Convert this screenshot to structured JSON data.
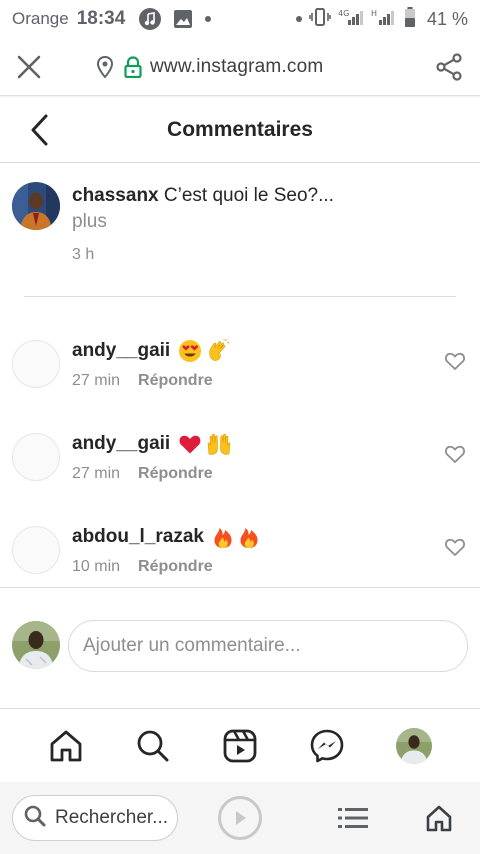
{
  "status_bar": {
    "carrier": "Orange",
    "time": "18:34",
    "battery": "41 %"
  },
  "browser": {
    "url": "www.instagram.com",
    "search_placeholder": "Rechercher..."
  },
  "header": {
    "title": "Commentaires"
  },
  "post": {
    "username": "chassanx",
    "caption": "C’est quoi le Seo?...",
    "more": "plus",
    "time": "3 h"
  },
  "comments": [
    {
      "username": "andy__gaii",
      "emojis": [
        "heart-eyes-emoji",
        "clap-emoji"
      ],
      "time": "27 min",
      "reply": "Répondre"
    },
    {
      "username": "andy__gaii",
      "emojis": [
        "red-heart-emoji",
        "raised-hands-emoji"
      ],
      "time": "27 min",
      "reply": "Répondre"
    },
    {
      "username": "abdou_l_razak",
      "emojis": [
        "fire-emoji",
        "fire-emoji"
      ],
      "time": "10 min",
      "reply": "Répondre"
    }
  ],
  "add_comment": {
    "placeholder": "Ajouter un commentaire..."
  },
  "colors": {
    "text": "#262626",
    "secondary": "#8e8e8e",
    "border": "#dbdbdb",
    "lock_green": "#0f9d58"
  }
}
